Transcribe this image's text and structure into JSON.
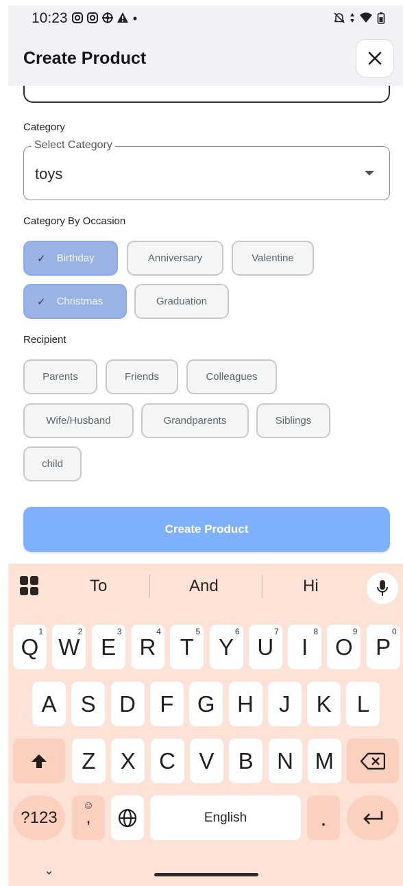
{
  "status_bar": {
    "time": "10:23"
  },
  "app_bar": {
    "title": "Create Product"
  },
  "category": {
    "label": "Category",
    "select_legend": "Select Category",
    "value": "toys"
  },
  "occasion": {
    "label": "Category By Occasion",
    "chips": [
      {
        "label": "Birthday",
        "selected": true
      },
      {
        "label": "Anniversary",
        "selected": false
      },
      {
        "label": "Valentine",
        "selected": false
      },
      {
        "label": "Christmas",
        "selected": true
      },
      {
        "label": "Graduation",
        "selected": false
      }
    ]
  },
  "recipient": {
    "label": "Recipient",
    "chips": [
      {
        "label": "Parents"
      },
      {
        "label": "Friends"
      },
      {
        "label": "Colleagues"
      },
      {
        "label": "Wife/Husband"
      },
      {
        "label": "Grandparents"
      },
      {
        "label": "Siblings"
      },
      {
        "label": "child"
      }
    ]
  },
  "create_button": "Create Product",
  "keyboard": {
    "suggestions": [
      "To",
      "And",
      "Hi"
    ],
    "row1": [
      "Q",
      "W",
      "E",
      "R",
      "T",
      "Y",
      "U",
      "I",
      "O",
      "P"
    ],
    "row1_numbers": [
      "1",
      "2",
      "3",
      "4",
      "5",
      "6",
      "7",
      "8",
      "9",
      "0"
    ],
    "row2": [
      "A",
      "S",
      "D",
      "F",
      "G",
      "H",
      "J",
      "K",
      "L"
    ],
    "row3": [
      "Z",
      "X",
      "C",
      "V",
      "B",
      "N",
      "M"
    ],
    "symbols_key": "?123",
    "comma_key": ",",
    "space_label": "English",
    "period_key": "."
  },
  "colors": {
    "accent_button": "#7fb0fc",
    "selected_chip": "#9ab2e4",
    "keyboard_bg": "#fde3d7"
  }
}
